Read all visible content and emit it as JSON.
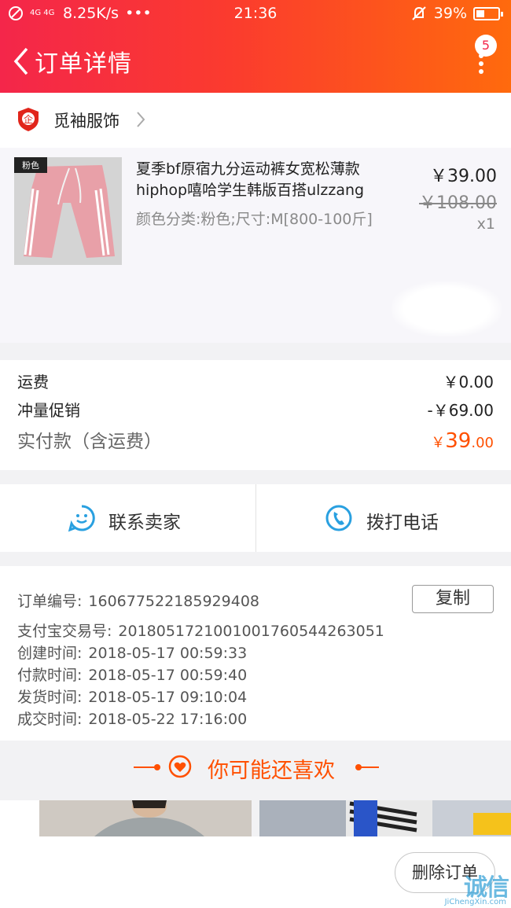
{
  "status_bar": {
    "network": "4G 4G",
    "speed": "8.25K/s",
    "dots": "•••",
    "time": "21:36",
    "battery": "39%"
  },
  "header": {
    "title": "订单详情",
    "badge_count": "5"
  },
  "shop": {
    "name": "觅袖服饰",
    "icon_glyph": "企"
  },
  "product": {
    "image_tag": "粉色",
    "title": "夏季bf原宿九分运动裤女宽松薄款hiphop嘻哈学生韩版百搭ulzzang",
    "sku": "颜色分类:粉色;尺寸:M[800-100斤]",
    "price": "￥39.00",
    "original_price": "￥108.00",
    "quantity": "x1"
  },
  "fees": {
    "shipping_label": "运费",
    "shipping_value": "￥0.00",
    "promo_label": "冲量促销",
    "promo_value": "-￥69.00",
    "total_label": "实付款（含运费）",
    "total_currency": "￥",
    "total_int": "39",
    "total_dec": ".00"
  },
  "actions": {
    "contact_seller": "联系卖家",
    "call_phone": "拨打电话"
  },
  "order_info": {
    "copy_label": "复制",
    "rows": [
      {
        "label": "订单编号:",
        "value": "160677522185929408"
      },
      {
        "label": "支付宝交易号:",
        "value": "2018051721001001760544263051"
      },
      {
        "label": "创建时间:",
        "value": "2018-05-17 00:59:33"
      },
      {
        "label": "付款时间:",
        "value": "2018-05-17 00:59:40"
      },
      {
        "label": "发货时间:",
        "value": "2018-05-17 09:10:04"
      },
      {
        "label": "成交时间:",
        "value": "2018-05-22 17:16:00"
      }
    ]
  },
  "recommend": {
    "title": "你可能还喜欢"
  },
  "bottom": {
    "delete_order": "删除订单"
  },
  "watermark": {
    "text": "诚信",
    "sub": "JiChengXin.com"
  },
  "colors": {
    "brand_gradient_start": "#f4264a",
    "brand_gradient_end": "#ff6a0d",
    "accent": "#ff5000",
    "contact_icon": "#29a0e0"
  }
}
